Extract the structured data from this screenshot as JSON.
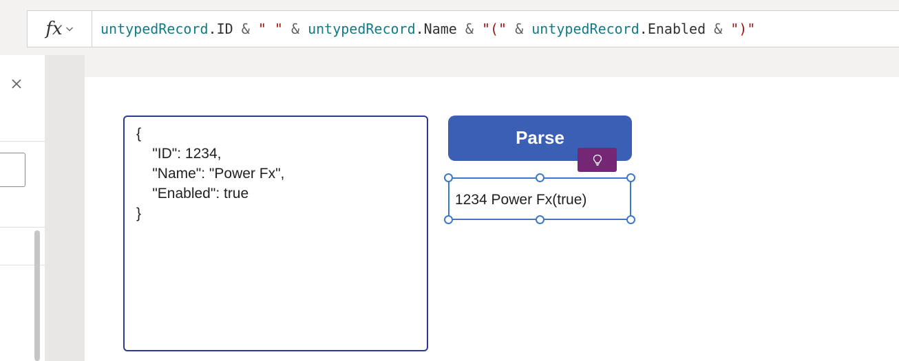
{
  "formula_bar": {
    "fx_label": "fx",
    "tokens": [
      {
        "text": "untypedRecord",
        "kind": "ident"
      },
      {
        "text": ".ID ",
        "kind": "prop"
      },
      {
        "text": "& ",
        "kind": "op"
      },
      {
        "text": "\" \" ",
        "kind": "str"
      },
      {
        "text": "& ",
        "kind": "op"
      },
      {
        "text": "untypedRecord",
        "kind": "ident"
      },
      {
        "text": ".Name ",
        "kind": "prop"
      },
      {
        "text": "& ",
        "kind": "op"
      },
      {
        "text": "\"(\" ",
        "kind": "str"
      },
      {
        "text": "& ",
        "kind": "op"
      },
      {
        "text": "untypedRecord",
        "kind": "ident"
      },
      {
        "text": ".Enabled ",
        "kind": "prop"
      },
      {
        "text": "& ",
        "kind": "op"
      },
      {
        "text": "\")\"",
        "kind": "str"
      }
    ]
  },
  "canvas": {
    "text_input": {
      "lines": [
        "{",
        "    \"ID\": 1234,",
        "    \"Name\": \"Power Fx\",",
        "    \"Enabled\": true",
        "}"
      ]
    },
    "parse_button": {
      "label": "Parse"
    },
    "result_label": {
      "text": "1234 Power Fx(true)"
    }
  },
  "colors": {
    "button_fill": "#3b5fb5",
    "selection_outline": "#3c77c9",
    "textarea_border": "#2b3a8f",
    "ident_token": "#0f7c86",
    "string_token": "#a31515",
    "idea_badge": "#742774"
  },
  "icons": {
    "close": "close-icon",
    "fx_dropdown": "chevron-down-icon",
    "idea": "lightbulb-icon"
  }
}
